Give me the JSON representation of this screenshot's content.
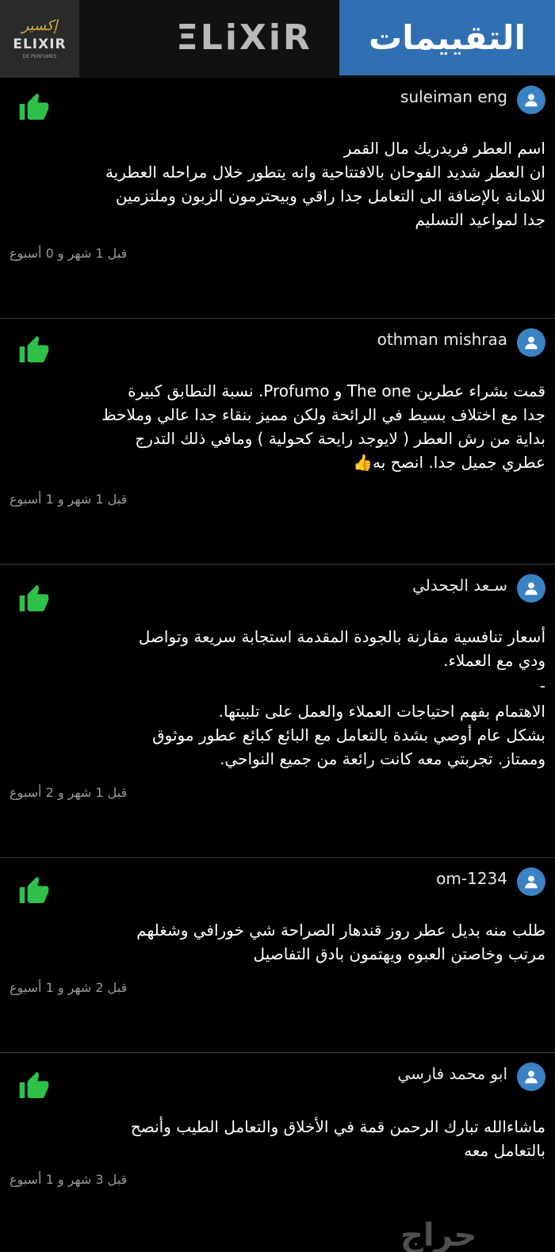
{
  "header": {
    "logo_ar": "إكسير",
    "logo_en": "ELIXIR",
    "logo_tiny": "DE PERFUMES",
    "brand": "ΞLiXiR",
    "title": "التقييمات"
  },
  "reviews": [
    {
      "user": "suleiman eng",
      "lines": [
        "اسم العطر فريدريك مال القمر",
        "ان العطر شديد الفوحان بالافتتاحية وانه يتطور خلال مراحله العطرية",
        "للامانة بالإضافة الى التعامل جدا راقي وبيحترمون الزبون وملتزمين",
        "جدا لمواعيد التسليم"
      ],
      "time": "قبل 1 شهر و 0 أسبوع"
    },
    {
      "user": "othman mishraa",
      "lines": [
        "قمت بشراء عطرين The one  و Profumo. نسبة التطابق كبيرة",
        "جدا مع اختلاف بسيط في الرائحة ولكن مميز بنقاء جدا عالي وملاحظ",
        "بداية من رش العطر ( لايوجد رايحة كحولية ) ومافي ذلك التدرج",
        "عطري جميل جدا. انصح به👍"
      ],
      "time": "قبل 1 شهر و 1 أسبوع"
    },
    {
      "user": "سـعد الجحدلي",
      "lines": [
        "أسعار تنافسية مقارنة بالجودة المقدمة  استجابة سريعة وتواصل",
        "ودي مع العملاء.",
        "-",
        "الاهتمام بفهم احتياجات العملاء والعمل على تلبيتها.",
        "بشكل عام  أوصي بشدة بالتعامل مع البائع كبائع عطور موثوق",
        "وممتاز. تجربتي معه كانت رائعة من جميع النواحي."
      ],
      "time": "قبل 1 شهر و 2 أسبوع"
    },
    {
      "user": "om-1234",
      "lines": [
        "طلب منه بديل عطر روز قندهار الصراحة شي خورافي وشغلهم",
        "مرتب وخاصتن العبوه ويهتمون بادق التفاصيل"
      ],
      "time": "قبل 2 شهر و 1 أسبوع"
    },
    {
      "user": "ابو محمد فارسي",
      "lines": [
        "ماشاءالله تبارك الرحمن قمة في الأخلاق والتعامل الطيب وأنصح",
        "بالتعامل معه"
      ],
      "time": "قبل 3 شهر و 1 أسبوع"
    }
  ],
  "watermark": "حراج",
  "icons": {
    "avatar": "user-avatar-icon",
    "thumb": "thumbs-up-icon"
  },
  "colors": {
    "header_blue": "#2f6fb2",
    "avatar_blue": "#3b82c4",
    "thumb_green": "#2ec14a"
  }
}
